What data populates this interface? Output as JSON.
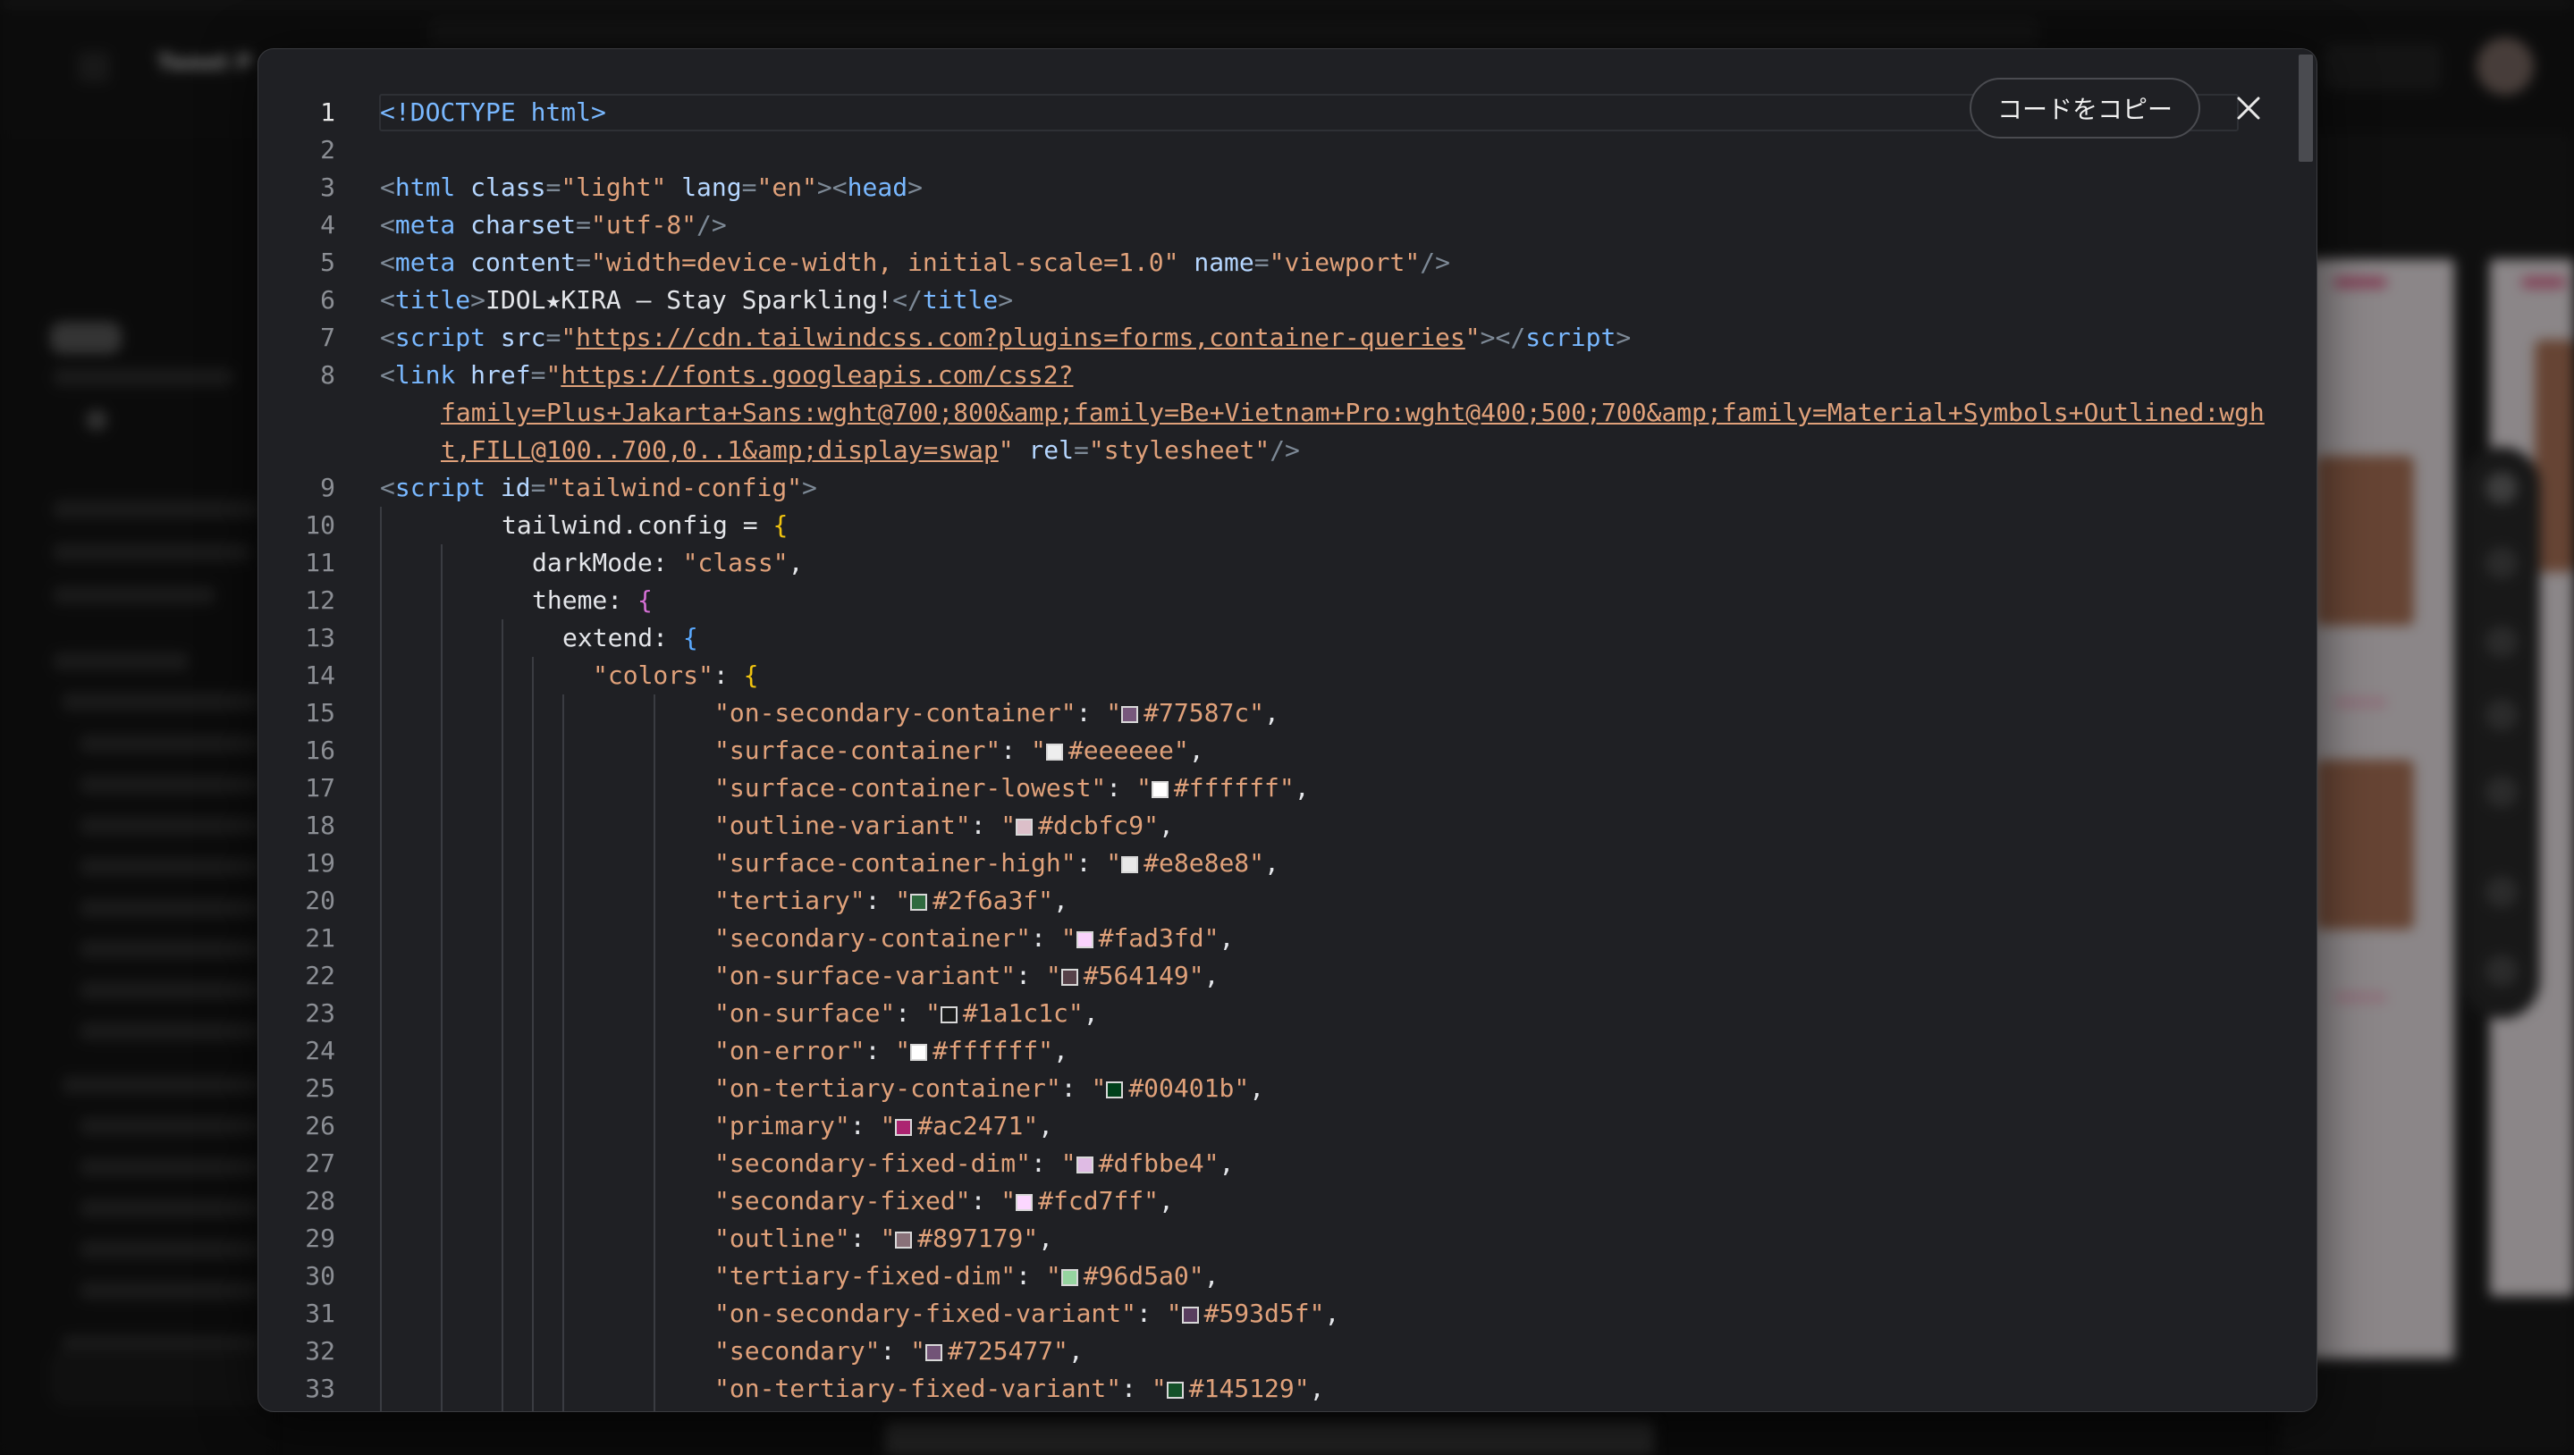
{
  "background_app": {
    "title": "Tweet P"
  },
  "modal": {
    "copy_label": "コードをコピー",
    "close_icon": "close-icon",
    "code_lines": [
      {
        "n": "1",
        "depth": 0,
        "parts": [
          {
            "c": "c-tagname",
            "t": "<!DOCTYPE html>"
          }
        ]
      },
      {
        "n": "2",
        "depth": 0,
        "parts": []
      },
      {
        "n": "3",
        "depth": 0,
        "parts": [
          {
            "c": "c-tag",
            "t": "<"
          },
          {
            "c": "c-tagname",
            "t": "html"
          },
          {
            "c": "c-plain",
            "t": " "
          },
          {
            "c": "c-attr",
            "t": "class"
          },
          {
            "c": "c-tag",
            "t": "="
          },
          {
            "c": "c-str",
            "t": "\"light\""
          },
          {
            "c": "c-plain",
            "t": " "
          },
          {
            "c": "c-attr",
            "t": "lang"
          },
          {
            "c": "c-tag",
            "t": "="
          },
          {
            "c": "c-str",
            "t": "\"en\""
          },
          {
            "c": "c-tag",
            "t": "><"
          },
          {
            "c": "c-tagname",
            "t": "head"
          },
          {
            "c": "c-tag",
            "t": ">"
          }
        ]
      },
      {
        "n": "4",
        "depth": 0,
        "parts": [
          {
            "c": "c-tag",
            "t": "<"
          },
          {
            "c": "c-tagname",
            "t": "meta"
          },
          {
            "c": "c-plain",
            "t": " "
          },
          {
            "c": "c-attr",
            "t": "charset"
          },
          {
            "c": "c-tag",
            "t": "="
          },
          {
            "c": "c-str",
            "t": "\"utf-8\""
          },
          {
            "c": "c-tag",
            "t": "/>"
          }
        ]
      },
      {
        "n": "5",
        "depth": 0,
        "parts": [
          {
            "c": "c-tag",
            "t": "<"
          },
          {
            "c": "c-tagname",
            "t": "meta"
          },
          {
            "c": "c-plain",
            "t": " "
          },
          {
            "c": "c-attr",
            "t": "content"
          },
          {
            "c": "c-tag",
            "t": "="
          },
          {
            "c": "c-str",
            "t": "\"width=device-width, initial-scale=1.0\""
          },
          {
            "c": "c-plain",
            "t": " "
          },
          {
            "c": "c-attr",
            "t": "name"
          },
          {
            "c": "c-tag",
            "t": "="
          },
          {
            "c": "c-str",
            "t": "\"viewport\""
          },
          {
            "c": "c-tag",
            "t": "/>"
          }
        ]
      },
      {
        "n": "6",
        "depth": 0,
        "parts": [
          {
            "c": "c-tag",
            "t": "<"
          },
          {
            "c": "c-tagname",
            "t": "title"
          },
          {
            "c": "c-tag",
            "t": ">"
          },
          {
            "c": "c-plain",
            "t": "IDOL★KIRA – Stay Sparkling!"
          },
          {
            "c": "c-tag",
            "t": "</"
          },
          {
            "c": "c-tagname",
            "t": "title"
          },
          {
            "c": "c-tag",
            "t": ">"
          }
        ]
      },
      {
        "n": "7",
        "depth": 0,
        "parts": [
          {
            "c": "c-tag",
            "t": "<"
          },
          {
            "c": "c-tagname",
            "t": "script"
          },
          {
            "c": "c-plain",
            "t": " "
          },
          {
            "c": "c-attr",
            "t": "src"
          },
          {
            "c": "c-tag",
            "t": "="
          },
          {
            "c": "c-str",
            "t": "\""
          },
          {
            "c": "c-link",
            "t": "https://cdn.tailwindcss.com?plugins=forms,container-queries"
          },
          {
            "c": "c-str",
            "t": "\""
          },
          {
            "c": "c-tag",
            "t": "></"
          },
          {
            "c": "c-tagname",
            "t": "script"
          },
          {
            "c": "c-tag",
            "t": ">"
          }
        ]
      },
      {
        "n": "8",
        "depth": 0,
        "parts": [
          {
            "c": "c-tag",
            "t": "<"
          },
          {
            "c": "c-tagname",
            "t": "link"
          },
          {
            "c": "c-plain",
            "t": " "
          },
          {
            "c": "c-attr",
            "t": "href"
          },
          {
            "c": "c-tag",
            "t": "="
          },
          {
            "c": "c-str",
            "t": "\""
          },
          {
            "c": "c-link",
            "t": "https://fonts.googleapis.com/css2?"
          }
        ]
      },
      {
        "n": "",
        "depth": 0,
        "cont": true,
        "parts": [
          {
            "c": "c-link",
            "t": "family=Plus+Jakarta+Sans:wght@700;800&amp;family=Be+Vietnam+Pro:wght@400;500;700&amp;family=Material+Symbols+Outlined:wgh"
          }
        ]
      },
      {
        "n": "",
        "depth": 0,
        "cont": true,
        "parts": [
          {
            "c": "c-link",
            "t": "t,FILL@100..700,0..1&amp;display=swap"
          },
          {
            "c": "c-str",
            "t": "\""
          },
          {
            "c": "c-plain",
            "t": " "
          },
          {
            "c": "c-attr",
            "t": "rel"
          },
          {
            "c": "c-tag",
            "t": "="
          },
          {
            "c": "c-str",
            "t": "\"stylesheet\""
          },
          {
            "c": "c-tag",
            "t": "/>"
          }
        ]
      },
      {
        "n": "9",
        "depth": 0,
        "parts": [
          {
            "c": "c-tag",
            "t": "<"
          },
          {
            "c": "c-tagname",
            "t": "script"
          },
          {
            "c": "c-plain",
            "t": " "
          },
          {
            "c": "c-attr",
            "t": "id"
          },
          {
            "c": "c-tag",
            "t": "="
          },
          {
            "c": "c-str",
            "t": "\"tailwind-config\""
          },
          {
            "c": "c-tag",
            "t": ">"
          }
        ]
      },
      {
        "n": "10",
        "depth": 1,
        "parts": [
          {
            "c": "c-plain",
            "t": "tailwind.config = "
          },
          {
            "c": "c-brace",
            "t": "{"
          }
        ]
      },
      {
        "n": "11",
        "depth": 2,
        "parts": [
          {
            "c": "c-plain",
            "t": "darkMode: "
          },
          {
            "c": "c-str",
            "t": "\"class\""
          },
          {
            "c": "c-plain",
            "t": ","
          }
        ]
      },
      {
        "n": "12",
        "depth": 2,
        "parts": [
          {
            "c": "c-plain",
            "t": "theme: "
          },
          {
            "c": "c-brace2",
            "t": "{"
          }
        ]
      },
      {
        "n": "13",
        "depth": 3,
        "parts": [
          {
            "c": "c-plain",
            "t": "extend: "
          },
          {
            "c": "c-brace3",
            "t": "{"
          }
        ]
      },
      {
        "n": "14",
        "depth": 4,
        "parts": [
          {
            "c": "c-str",
            "t": "\"colors\""
          },
          {
            "c": "c-plain",
            "t": ": "
          },
          {
            "c": "c-brace",
            "t": "{"
          }
        ]
      },
      {
        "n": "15",
        "depth": 5,
        "key": "on-secondary-container",
        "color": "#77587c"
      },
      {
        "n": "16",
        "depth": 5,
        "key": "surface-container",
        "color": "#eeeeee"
      },
      {
        "n": "17",
        "depth": 5,
        "key": "surface-container-lowest",
        "color": "#ffffff"
      },
      {
        "n": "18",
        "depth": 5,
        "key": "outline-variant",
        "color": "#dcbfc9"
      },
      {
        "n": "19",
        "depth": 5,
        "key": "surface-container-high",
        "color": "#e8e8e8"
      },
      {
        "n": "20",
        "depth": 5,
        "key": "tertiary",
        "color": "#2f6a3f"
      },
      {
        "n": "21",
        "depth": 5,
        "key": "secondary-container",
        "color": "#fad3fd"
      },
      {
        "n": "22",
        "depth": 5,
        "key": "on-surface-variant",
        "color": "#564149"
      },
      {
        "n": "23",
        "depth": 5,
        "key": "on-surface",
        "color": "#1a1c1c"
      },
      {
        "n": "24",
        "depth": 5,
        "key": "on-error",
        "color": "#ffffff"
      },
      {
        "n": "25",
        "depth": 5,
        "key": "on-tertiary-container",
        "color": "#00401b"
      },
      {
        "n": "26",
        "depth": 5,
        "key": "primary",
        "color": "#ac2471"
      },
      {
        "n": "27",
        "depth": 5,
        "key": "secondary-fixed-dim",
        "color": "#dfbbe4"
      },
      {
        "n": "28",
        "depth": 5,
        "key": "secondary-fixed",
        "color": "#fcd7ff"
      },
      {
        "n": "29",
        "depth": 5,
        "key": "outline",
        "color": "#897179"
      },
      {
        "n": "30",
        "depth": 5,
        "key": "tertiary-fixed-dim",
        "color": "#96d5a0"
      },
      {
        "n": "31",
        "depth": 5,
        "key": "on-secondary-fixed-variant",
        "color": "#593d5f"
      },
      {
        "n": "32",
        "depth": 5,
        "key": "secondary",
        "color": "#725477"
      },
      {
        "n": "33",
        "depth": 5,
        "key": "on-tertiary-fixed-variant",
        "color": "#145129"
      }
    ]
  }
}
